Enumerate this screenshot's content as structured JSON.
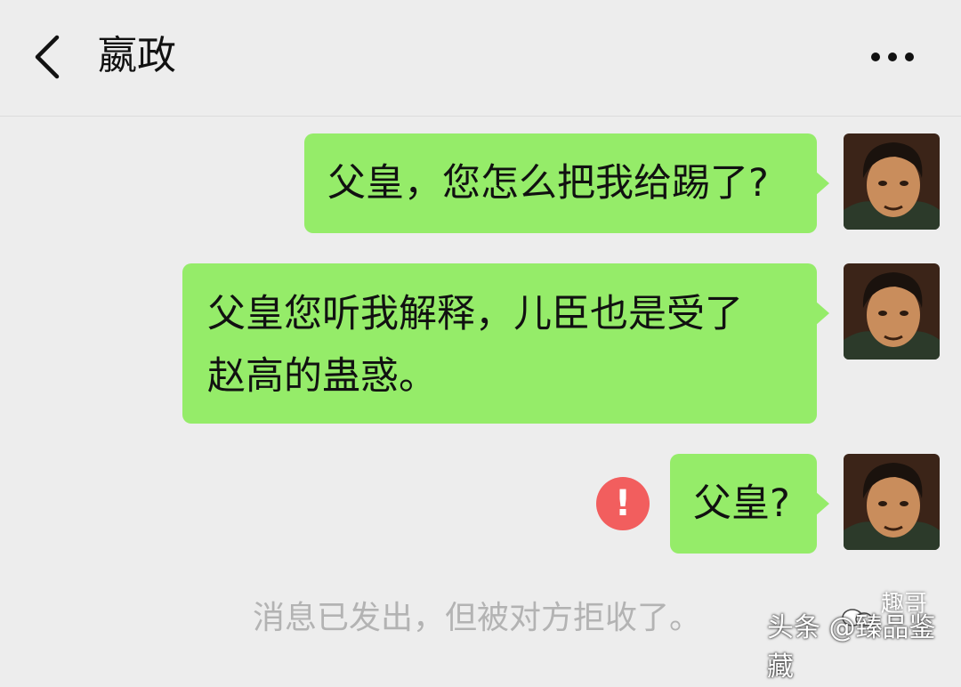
{
  "header": {
    "title": "嬴政"
  },
  "messages": [
    {
      "lines": [
        "父皇，您怎么把我给踢了?"
      ]
    },
    {
      "lines": [
        "父皇您听我解释，儿臣也是受了",
        "赵高的蛊惑。"
      ]
    },
    {
      "lines": [
        "父皇?"
      ],
      "status": "failed"
    }
  ],
  "system_notice": "消息已发出，但被对方拒收了。",
  "watermark": {
    "main": "头条 @臻品鉴藏",
    "top": "趣哥"
  },
  "colors": {
    "background": "#ededed",
    "bubble": "#95ec69",
    "error": "#f25e5e",
    "notice_text": "#b3b3b3"
  },
  "icons": [
    "back-arrow-icon",
    "more-dots-icon",
    "error-exclamation-icon",
    "wechat-logo-icon"
  ]
}
